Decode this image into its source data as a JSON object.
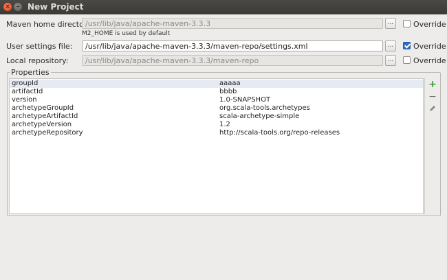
{
  "window": {
    "title": "New Project"
  },
  "maven_home": {
    "label": "Maven home directory:",
    "value": "/usr/lib/java/apache-maven-3.3.3",
    "hint": "M2_HOME is used by default",
    "browse_label": "...",
    "override_label": "Override",
    "override_checked": false
  },
  "user_settings": {
    "label": "User settings file:",
    "value": "/usr/lib/java/apache-maven-3.3.3/maven-repo/settings.xml",
    "browse_label": "...",
    "override_label": "Override",
    "override_checked": true
  },
  "local_repo": {
    "label": "Local repository:",
    "value": "/usr/lib/java/apache-maven-3.3.3/maven-repo",
    "browse_label": "...",
    "override_label": "Override",
    "override_checked": false
  },
  "properties": {
    "title": "Properties",
    "rows": [
      {
        "key": "groupId",
        "value": "aaaaa"
      },
      {
        "key": "artifactId",
        "value": "bbbb"
      },
      {
        "key": "version",
        "value": "1.0-SNAPSHOT"
      },
      {
        "key": "archetypeGroupId",
        "value": "org.scala-tools.archetypes"
      },
      {
        "key": "archetypeArtifactId",
        "value": "scala-archetype-simple"
      },
      {
        "key": "archetypeVersion",
        "value": "1.2"
      },
      {
        "key": "archetypeRepository",
        "value": "http://scala-tools.org/repo-releases"
      }
    ],
    "toolbar": {
      "add_icon": "plus-icon",
      "remove_icon": "minus-icon",
      "edit_icon": "pencil-icon"
    }
  },
  "colors": {
    "accent": "#2c6fc1",
    "add": "#3a9a3a",
    "selected_row": "#e6eaf3"
  }
}
